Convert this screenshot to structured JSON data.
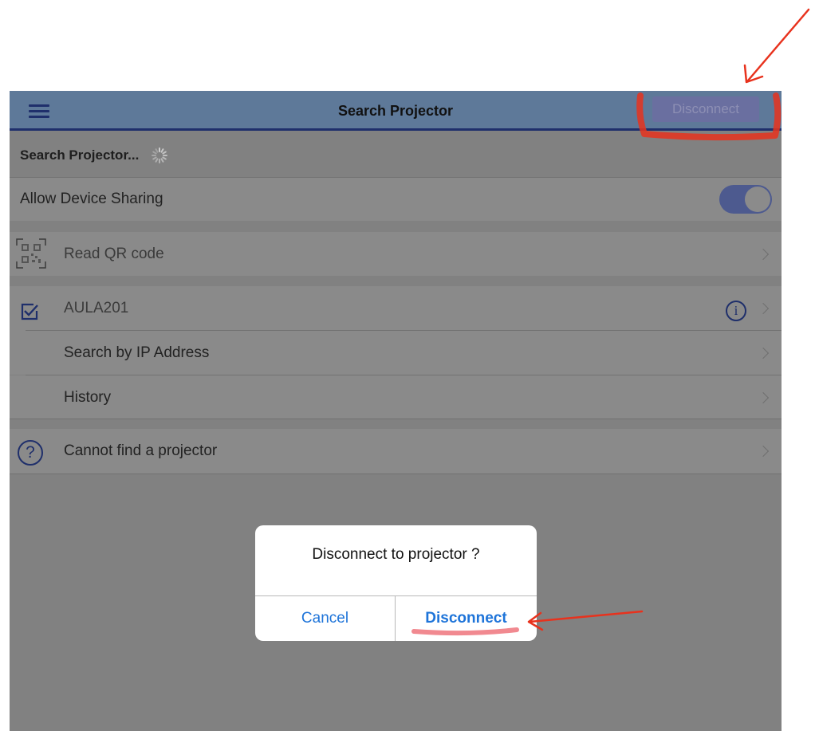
{
  "navbar": {
    "title": "Search Projector",
    "disconnect_label": "Disconnect",
    "menu_icon": "hamburger-menu-icon"
  },
  "status": {
    "searching_text": "Search Projector...",
    "spinner_icon": "loading-spinner-icon"
  },
  "sharing": {
    "label": "Allow Device Sharing",
    "enabled": true
  },
  "qr": {
    "label": "Read QR code",
    "icon": "qr-code-icon"
  },
  "projectors": {
    "items": [
      {
        "name": "AULA201",
        "selected": true,
        "icon": "checkbox-checked-icon",
        "info_icon": "info-icon"
      }
    ],
    "search_ip_label": "Search by IP Address",
    "history_label": "History"
  },
  "help": {
    "label": "Cannot find a projector",
    "icon": "question-mark-icon",
    "glyph": "?"
  },
  "dialog": {
    "message": "Disconnect to projector ?",
    "cancel_label": "Cancel",
    "confirm_label": "Disconnect"
  },
  "colors": {
    "navbar": "#5e7999",
    "navbar_border": "#1f2f6b",
    "overlay_background": "#818181",
    "toggle_on": "#4d5a8f",
    "dialog_button": "#1e74d9",
    "annotation": "#e8321d"
  }
}
